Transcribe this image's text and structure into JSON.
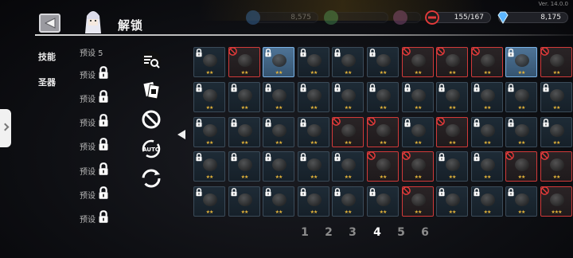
{
  "header": {
    "title": "解锁",
    "version": "Ver. 14.0.0"
  },
  "resources": {
    "bar1": {
      "value": "8,575",
      "color": "#4a90d9"
    },
    "bar2": {
      "value": "",
      "color": "#5fbf6a"
    },
    "bar3": {
      "value": "",
      "color": "#c06aa6"
    },
    "energy": {
      "value": "155/167",
      "icon": "no-entry-icon",
      "color": "#d33"
    },
    "gems": {
      "value": "8,175",
      "icon": "diamond-icon",
      "color": "#5cb6ff"
    }
  },
  "side_tabs": [
    {
      "label": "技能"
    },
    {
      "label": "圣器"
    }
  ],
  "presets": [
    {
      "label": "预设 5"
    },
    {
      "label": "预设"
    },
    {
      "label": "预设"
    },
    {
      "label": "预设"
    },
    {
      "label": "预设"
    },
    {
      "label": "预设"
    },
    {
      "label": "预设"
    },
    {
      "label": "预设"
    }
  ],
  "skill_icons": [
    "search-list-icon",
    "card-swap-icon",
    "cancel-ring-icon",
    "auto-cycle-icon",
    "refresh-cycle-icon"
  ],
  "skill_labels": {
    "auto": "AUTO"
  },
  "grid": {
    "rows": [
      [
        "lock",
        "red",
        "sel",
        "lock",
        "lock",
        "lock",
        "red",
        "red",
        "red",
        "sel",
        "red"
      ],
      [
        "lock",
        "lock",
        "lock",
        "lock",
        "lock",
        "lock",
        "lock",
        "lock",
        "lock",
        "lock",
        "lock"
      ],
      [
        "lock",
        "lock",
        "lock",
        "lock",
        "red",
        "red",
        "lock",
        "red",
        "lock",
        "lock",
        "lock"
      ],
      [
        "lock",
        "lock",
        "lock",
        "lock",
        "lock",
        "red",
        "red",
        "lock",
        "lock",
        "red",
        "red"
      ],
      [
        "lock",
        "lock",
        "lock",
        "lock",
        "lock",
        "lock",
        "red",
        "lock",
        "lock",
        "lock",
        "red"
      ]
    ],
    "stars": [
      [
        "★★",
        "★★",
        "★★",
        "★★",
        "★★",
        "★★",
        "★★",
        "★★",
        "★★",
        "★★",
        "★★"
      ],
      [
        "★★",
        "★★",
        "★★",
        "★★",
        "★★",
        "★★",
        "★★",
        "★★",
        "★★",
        "★★",
        "★★"
      ],
      [
        "★★",
        "★★",
        "★★",
        "★★",
        "★★",
        "★★",
        "★★",
        "★★",
        "★★",
        "★★",
        "★★"
      ],
      [
        "★★",
        "★★",
        "★★",
        "★★",
        "★★",
        "★★",
        "★★",
        "★★",
        "★★",
        "★★",
        "★★"
      ],
      [
        "★★",
        "★★",
        "★★",
        "★★",
        "★★",
        "★★",
        "★★",
        "★★",
        "★★",
        "★★",
        "★★★"
      ]
    ]
  },
  "pagination": {
    "pages": [
      "1",
      "2",
      "3",
      "4",
      "5",
      "6"
    ],
    "active": "4"
  }
}
